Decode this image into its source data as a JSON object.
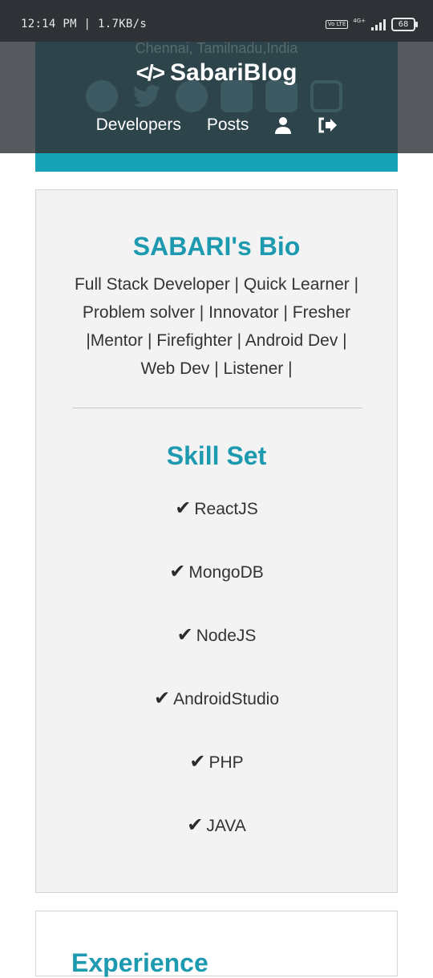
{
  "status_bar": {
    "time": "12:14 PM | 1.7KB/s",
    "volte_label": "Vo LTE",
    "network_label": "4G+",
    "battery": "68"
  },
  "header": {
    "location": "Chennai, Tamilnadu,India",
    "brand_name": "SabariBlog",
    "brand_icon": "code-icon",
    "nav": {
      "developers": "Developers",
      "posts": "Posts"
    },
    "nav_icons": [
      "user-icon",
      "sign-out-icon"
    ],
    "social_icons": [
      "globe-icon",
      "twitter-icon",
      "facebook-icon",
      "linkedin-icon",
      "youtube-icon",
      "instagram-icon"
    ]
  },
  "bio": {
    "title": "SABARI's Bio",
    "lines": [
      "Full Stack Developer | Quick Learner |",
      "Problem solver | Innovator | Fresher",
      "|Mentor | Firefighter | Android Dev |",
      "Web Dev | Listener |"
    ]
  },
  "skills": {
    "title": "Skill Set",
    "items": [
      "ReactJS",
      "MongoDB",
      "NodeJS",
      "AndroidStudio",
      "PHP",
      "JAVA"
    ]
  },
  "next_card": {
    "title": "Experience"
  },
  "colors": {
    "accent": "#1d9ab0",
    "header_bg": "#2d444b",
    "strip": "#17a2b8"
  }
}
